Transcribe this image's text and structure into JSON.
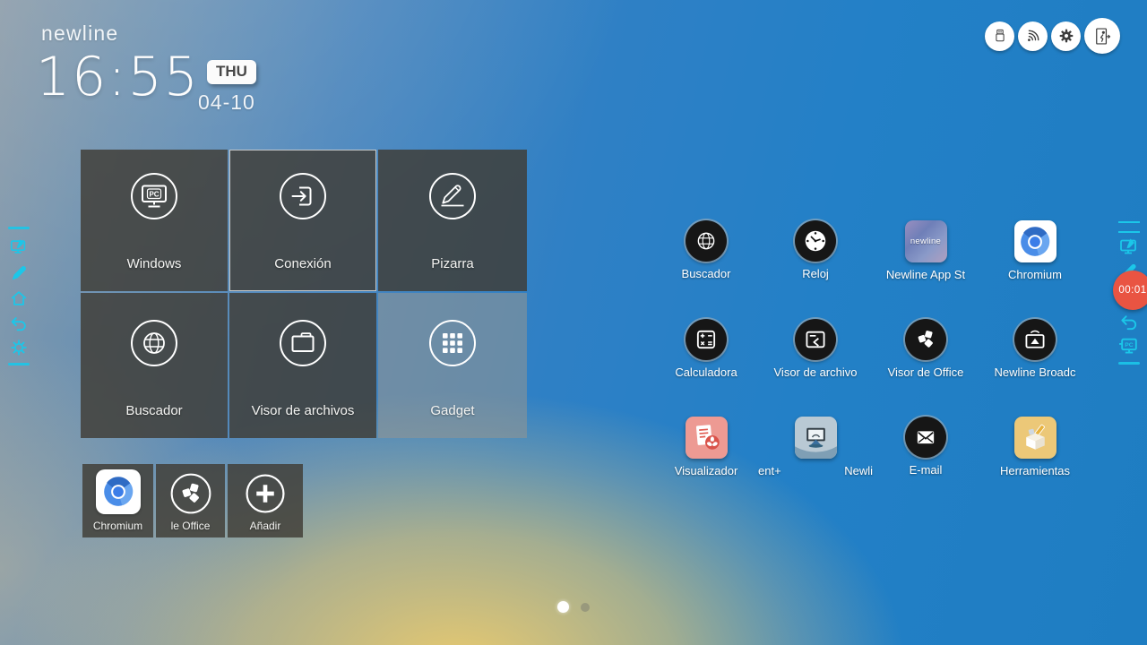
{
  "header": {
    "logo": "newline",
    "time": "16:55",
    "day_badge": "THU",
    "date": "04-10"
  },
  "quick_buttons": [
    {
      "icon": "usb-icon"
    },
    {
      "icon": "hotspot-icon"
    },
    {
      "icon": "settings-gear-icon"
    },
    {
      "icon": "exit-icon"
    }
  ],
  "main_tiles": [
    {
      "label": "Windows",
      "icon": "pc-monitor-icon"
    },
    {
      "label": "Conexión",
      "icon": "connection-enter-icon",
      "selected": true
    },
    {
      "label": "Pizarra",
      "icon": "whiteboard-pen-icon"
    },
    {
      "label": "Buscador",
      "icon": "globe-icon"
    },
    {
      "label": "Visor de archivos",
      "icon": "folder-icon"
    },
    {
      "label": "Gadget",
      "icon": "apps-grid-icon",
      "light": true
    }
  ],
  "shortcut_tiles": [
    {
      "label": "Chromium",
      "icon": "chromium-logo-icon"
    },
    {
      "label": "le Office",
      "icon": "office-dice-icon"
    },
    {
      "label": "Añadir",
      "icon": "add-plus-icon"
    }
  ],
  "apps": {
    "r0c0": {
      "label": "Buscador",
      "icon": "globe-icon"
    },
    "r0c1": {
      "label": "Reloj",
      "icon": "clock-icon"
    },
    "r0c2": {
      "label": "Newline App St",
      "icon": "newline-store-icon",
      "icon_text": "newline"
    },
    "r0c3": {
      "label": "Chromium",
      "icon": "chromium-logo-icon"
    },
    "r1c0": {
      "label": "Calculadora",
      "icon": "calculator-icon"
    },
    "r1c1": {
      "label": "Visor de archivo",
      "icon": "file-viewer-icon"
    },
    "r1c2": {
      "label": "Visor de Office",
      "icon": "office-dice-icon"
    },
    "r1c3": {
      "label": "Newline Broadc",
      "icon": "broadcast-cast-icon"
    },
    "r2c0": {
      "label": "Visualizador",
      "icon": "visualizer-doc-icon"
    },
    "r2c1": {
      "label_left": "ent+",
      "label_right": "Newli",
      "icon": "present-screen-icon"
    },
    "r2c2": {
      "label": "E-mail",
      "icon": "envelope-icon"
    },
    "r2c3": {
      "label": "Herramientas",
      "icon": "toolbox-icon"
    }
  },
  "left_toolbar": {
    "icons": [
      "annotate-screen-icon",
      "pen-icon",
      "home-icon",
      "return-icon",
      "widgets-icon"
    ]
  },
  "right_toolbar": {
    "icons": [
      "annotate-screen-icon",
      "pen-icon",
      "return-icon",
      "pc-screen-icon"
    ],
    "timer": "00:01"
  },
  "pager": {
    "total": 2,
    "active_index": 0
  },
  "colors": {
    "accent_cyan": "#1bc7e9",
    "timer_red": "#e95442",
    "bg_blue": "#2380c7",
    "bg_gold": "#f3ce6a",
    "tile_dark": "rgba(63,60,53,0.82)"
  }
}
